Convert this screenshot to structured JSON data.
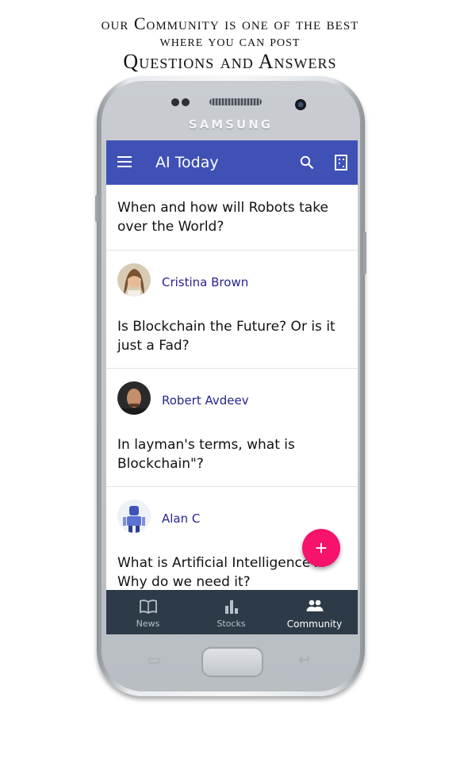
{
  "promo": {
    "line1": "our Community is one of the best",
    "line2": "where you can post",
    "line3": "Questions and Answers"
  },
  "device": {
    "brand": "SAMSUNG"
  },
  "app": {
    "title": "AI Today",
    "accent_color": "#3f51b5",
    "fab_color": "#f5136c",
    "fab_label": "+"
  },
  "feed": {
    "first_question": "When and how will Robots take over the World?",
    "posts": [
      {
        "author": "Cristina Brown",
        "question": "Is Blockchain the Future? Or is it just a Fad?",
        "avatar": "woman-avatar"
      },
      {
        "author": "Robert Avdeev",
        "question": "In layman's terms, what is Blockchain\"?",
        "avatar": "man-avatar"
      },
      {
        "author": "Alan C",
        "question": "What is Artificial Intelligence A Why do we need it?",
        "avatar": "robot-avatar"
      }
    ]
  },
  "bottom_nav": {
    "items": [
      {
        "label": "News",
        "icon": "book-icon"
      },
      {
        "label": "Stocks",
        "icon": "bar-chart-icon"
      },
      {
        "label": "Community",
        "icon": "people-icon",
        "active": true
      }
    ]
  }
}
